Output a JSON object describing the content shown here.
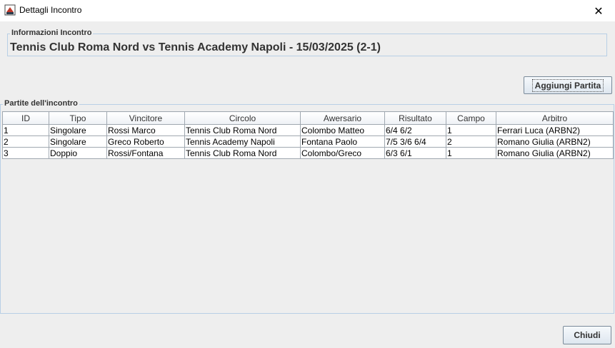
{
  "window": {
    "title": "Dettagli Incontro",
    "close_symbol": "✕"
  },
  "info": {
    "legend": "Informazioni Incontro",
    "match_title": "Tennis Club Roma Nord vs Tennis Academy Napoli - 15/03/2025 (2-1)"
  },
  "buttons": {
    "add_match": "Aggiungi Partita",
    "close": "Chiudi"
  },
  "matches": {
    "legend": "Partite dell'incontro",
    "columns": [
      "ID",
      "Tipo",
      "Vincitore",
      "Circolo",
      "Awersario",
      "Risultato",
      "Campo",
      "Arbitro"
    ],
    "rows": [
      [
        "1",
        "Singolare",
        "Rossi Marco",
        "Tennis Club Roma Nord",
        "Colombo Matteo",
        "6/4 6/2",
        "1",
        "Ferrari Luca (ARBN2)"
      ],
      [
        "2",
        "Singolare",
        "Greco Roberto",
        "Tennis Academy Napoli",
        "Fontana Paolo",
        "7/5 3/6 6/4",
        "2",
        "Romano Giulia (ARBN2)"
      ],
      [
        "3",
        "Doppio",
        "Rossi/Fontana",
        "Tennis Club Roma Nord",
        "Colombo/Greco",
        "6/3 6/1",
        "1",
        "Romano Giulia (ARBN2)"
      ]
    ]
  },
  "icons": {
    "app": "java-app-icon",
    "close": "close-icon"
  }
}
